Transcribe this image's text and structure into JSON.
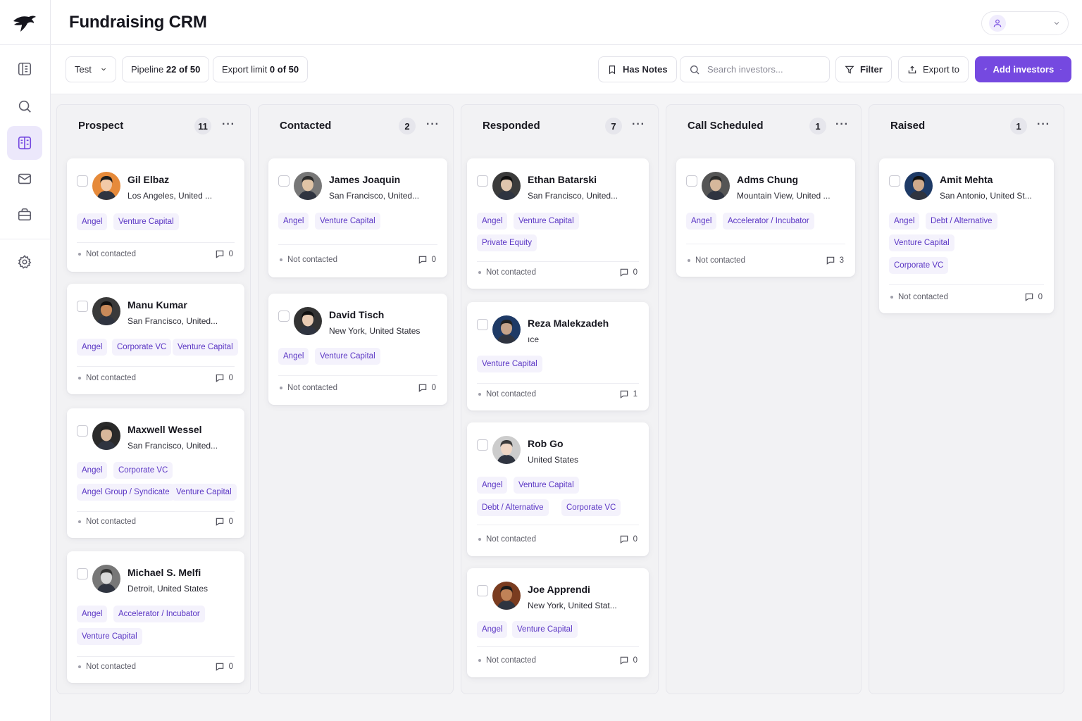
{
  "app": {
    "title": "Fundraising CRM"
  },
  "sidebar": {
    "items": [
      {
        "icon": "layout-panel-icon"
      },
      {
        "icon": "search-icon"
      },
      {
        "icon": "kanban-board-icon",
        "active": true
      },
      {
        "icon": "mail-icon"
      },
      {
        "icon": "briefcase-icon"
      },
      {
        "icon": "gear-icon"
      }
    ]
  },
  "toolbar": {
    "list_select": "Test",
    "pipeline_label": "Pipeline",
    "pipeline_value": "22 of 50",
    "export_limit_label": "Export limit",
    "export_limit_value": "0 of 50",
    "has_notes": "Has Notes",
    "search_placeholder": "Search investors...",
    "filter": "Filter",
    "export": "Export to",
    "add_investors": "Add investors"
  },
  "colors": {
    "accent": "#7549e0",
    "tag_bg": "#f4f2fc",
    "tag_text": "#5a35c4"
  },
  "columns": [
    {
      "title": "Prospect",
      "count": "11",
      "cards": [
        {
          "name": "Gil Elbaz",
          "location": "Los Angeles, United ...",
          "tags": [
            "Angel",
            "Venture Capital"
          ],
          "status": "Not contacted",
          "notes": "0"
        },
        {
          "name": "Manu Kumar",
          "location": "San Francisco, United...",
          "tags": [
            "Angel",
            "Corporate VC",
            "Venture Capital"
          ],
          "status": "Not contacted",
          "notes": "0"
        },
        {
          "name": "Maxwell Wessel",
          "location": "San Francisco, United...",
          "tags": [
            "Angel",
            "Corporate VC",
            "Angel Group / Syndicate",
            "Venture Capital"
          ],
          "status": "Not contacted",
          "notes": "0"
        },
        {
          "name": "Michael S. Melfi",
          "location": "Detroit, United States",
          "tags": [
            "Angel",
            "Accelerator / Incubator",
            "Venture Capital"
          ],
          "status": "Not contacted",
          "notes": "0"
        }
      ]
    },
    {
      "title": "Contacted",
      "count": "2",
      "cards": [
        {
          "name": "James Joaquin",
          "location": "San Francisco, United...",
          "tags": [
            "Angel",
            "Venture Capital"
          ],
          "status": "Not contacted",
          "notes": "0"
        },
        {
          "name": "David Tisch",
          "location": "New York, United States",
          "tags": [
            "Angel",
            "Venture Capital"
          ],
          "status": "Not contacted",
          "notes": "0"
        }
      ]
    },
    {
      "title": "Responded",
      "count": "7",
      "cards": [
        {
          "name": "Ethan Batarski",
          "location": "San Francisco, United...",
          "tags": [
            "Angel",
            "Venture Capital",
            "Private Equity"
          ],
          "status": "Not contacted",
          "notes": "0"
        },
        {
          "name": "Reza Malekzadeh",
          "location": "ıce",
          "tags": [
            "Venture Capital"
          ],
          "status": "Not contacted",
          "notes": "1"
        },
        {
          "name": "Rob Go",
          "location": "United States",
          "tags": [
            "Angel",
            "Venture Capital",
            "Debt / Alternative",
            "Corporate VC"
          ],
          "status": "Not contacted",
          "notes": "0"
        },
        {
          "name": "Joe Apprendi",
          "location": "New York, United Stat...",
          "tags": [
            "Angel",
            "Venture Capital"
          ],
          "status": "Not contacted",
          "notes": "0"
        }
      ]
    },
    {
      "title": "Call Scheduled",
      "count": "1",
      "cards": [
        {
          "name": "Adms Chung",
          "location": "Mountain View, United ...",
          "tags": [
            "Angel",
            "Accelerator / Incubator"
          ],
          "status": "Not contacted",
          "notes": "3"
        }
      ]
    },
    {
      "title": "Raised",
      "count": "1",
      "cards": [
        {
          "name": "Amit Mehta",
          "location": "San Antonio, United St...",
          "tags": [
            "Angel",
            "Debt / Alternative",
            "Venture Capital",
            "Corporate VC"
          ],
          "status": "Not contacted",
          "notes": "0"
        }
      ]
    }
  ]
}
